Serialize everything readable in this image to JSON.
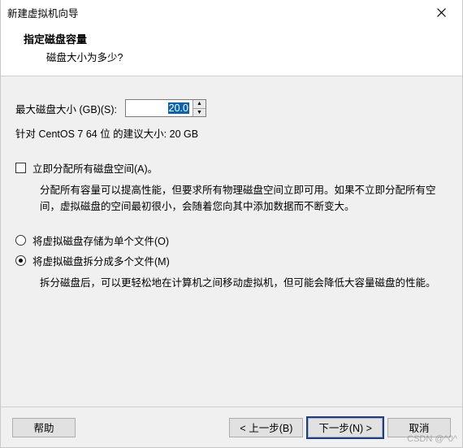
{
  "window": {
    "title": "新建虚拟机向导",
    "close_label": "Close"
  },
  "header": {
    "heading": "指定磁盘容量",
    "sub": "磁盘大小为多少?"
  },
  "size": {
    "label": "最大磁盘大小 (GB)(S):",
    "value": "20.0"
  },
  "recommend": "针对 CentOS 7 64 位 的建议大小: 20 GB",
  "allocate": {
    "label": "立即分配所有磁盘空间(A)。",
    "checked": false,
    "desc": "分配所有容量可以提高性能，但要求所有物理磁盘空间立即可用。如果不立即分配所有空间，虚拟磁盘的空间最初很小，会随着您向其中添加数据而不断变大。"
  },
  "disk_file": {
    "single": {
      "label": "将虚拟磁盘存储为单个文件(O)",
      "checked": false
    },
    "split": {
      "label": "将虚拟磁盘拆分成多个文件(M)",
      "checked": true,
      "desc": "拆分磁盘后，可以更轻松地在计算机之间移动虚拟机，但可能会降低大容量磁盘的性能。"
    }
  },
  "footer": {
    "help": "帮助",
    "back": "< 上一步(B)",
    "next": "下一步(N) >",
    "cancel": "取消"
  },
  "watermark": "CSDN @^0^"
}
